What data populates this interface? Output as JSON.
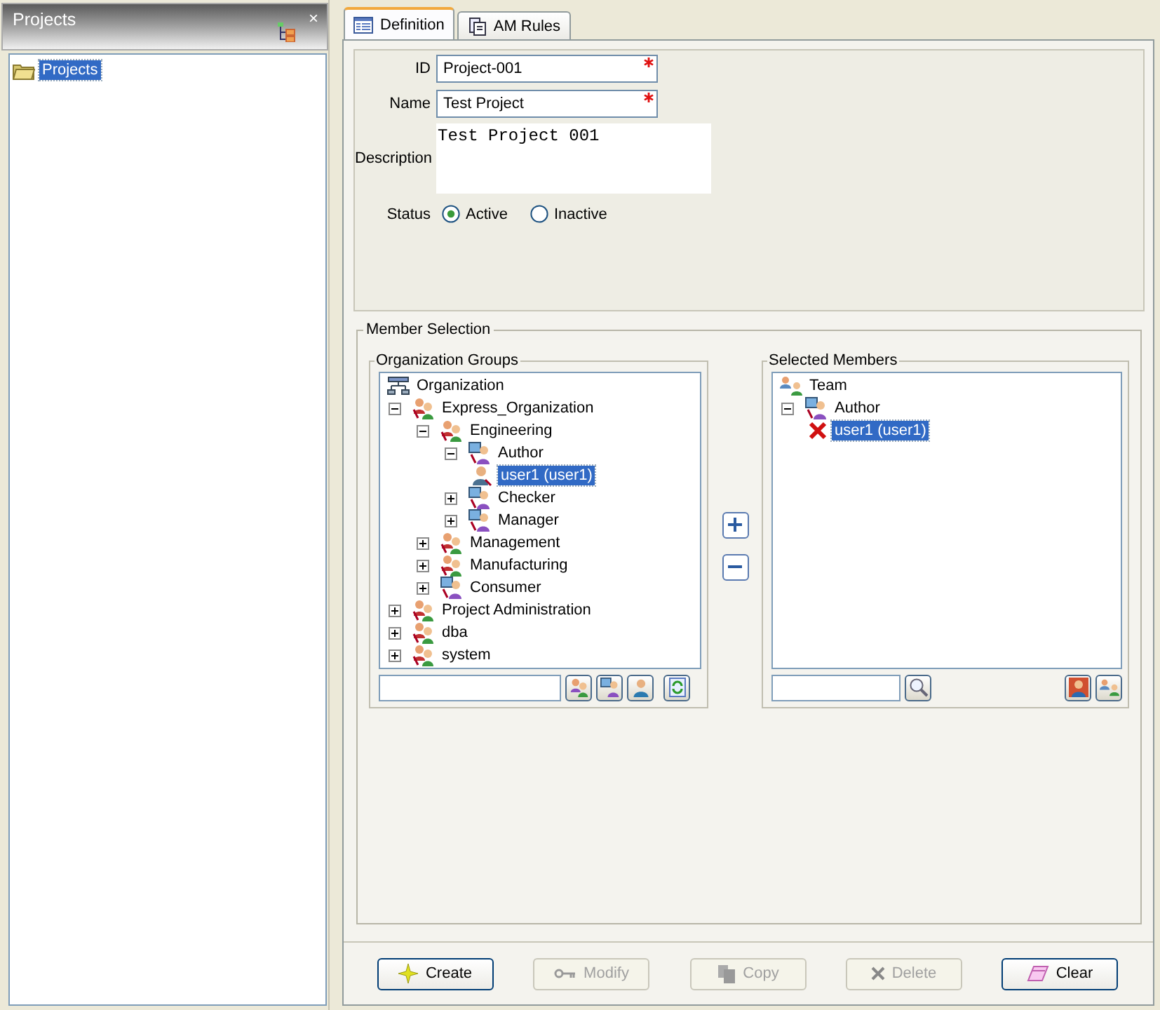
{
  "sidebar": {
    "title": "Projects",
    "close": "×",
    "items": [
      {
        "label": "Projects",
        "selected": true
      }
    ]
  },
  "tabs": [
    {
      "label": "Definition",
      "selected": true
    },
    {
      "label": "AM Rules",
      "selected": false
    }
  ],
  "definition": {
    "fields": [
      {
        "label": "ID",
        "value": "Project-001",
        "required": true,
        "kind": "text"
      },
      {
        "label": "Name",
        "value": "Test Project",
        "required": true,
        "kind": "text"
      },
      {
        "label": "Description",
        "value": "Test Project 001",
        "kind": "textarea"
      }
    ],
    "status": {
      "label": "Status",
      "options": [
        {
          "label": "Active",
          "selected": true
        },
        {
          "label": "Inactive",
          "selected": false
        }
      ]
    }
  },
  "member_selection": {
    "title": "Member Selection",
    "org_groups": {
      "title": "Organization Groups",
      "tree": [
        {
          "label": "Organization",
          "kind": "org",
          "selected": false
        },
        {
          "label": "Express_Organization",
          "kind": "group",
          "expanded": true,
          "selected": false,
          "children": [
            {
              "label": "Engineering",
              "kind": "group",
              "expanded": true,
              "selected": false,
              "children": [
                {
                  "label": "Author",
                  "kind": "role",
                  "expanded": true,
                  "selected": false,
                  "children": [
                    {
                      "label": "user1 (user1)",
                      "kind": "user",
                      "selected": true
                    }
                  ]
                },
                {
                  "label": "Checker",
                  "kind": "role",
                  "expanded": false,
                  "selected": false
                },
                {
                  "label": "Manager",
                  "kind": "role",
                  "expanded": false,
                  "selected": false
                }
              ]
            },
            {
              "label": "Management",
              "kind": "group",
              "expanded": false,
              "selected": false
            },
            {
              "label": "Manufacturing",
              "kind": "group",
              "expanded": false,
              "selected": false
            },
            {
              "label": "Consumer",
              "kind": "role",
              "expanded": false,
              "selected": false
            }
          ]
        },
        {
          "label": "Project Administration",
          "kind": "group",
          "expanded": false,
          "selected": false
        },
        {
          "label": "dba",
          "kind": "group",
          "expanded": false,
          "selected": false
        },
        {
          "label": "system",
          "kind": "group",
          "expanded": false,
          "selected": false
        }
      ]
    },
    "selected_members": {
      "title": "Selected Members",
      "tree": [
        {
          "label": "Team",
          "kind": "team",
          "selected": false
        },
        {
          "label": "Author",
          "kind": "role",
          "expanded": true,
          "selected": false,
          "children": [
            {
              "label": "user1 (user1)",
              "kind": "removal",
              "selected": true
            }
          ]
        }
      ]
    }
  },
  "buttons": [
    {
      "label": "Create",
      "disabled": false
    },
    {
      "label": "Modify",
      "disabled": true
    },
    {
      "label": "Copy",
      "disabled": true
    },
    {
      "label": "Delete",
      "disabled": true
    },
    {
      "label": "Clear",
      "disabled": false
    }
  ]
}
